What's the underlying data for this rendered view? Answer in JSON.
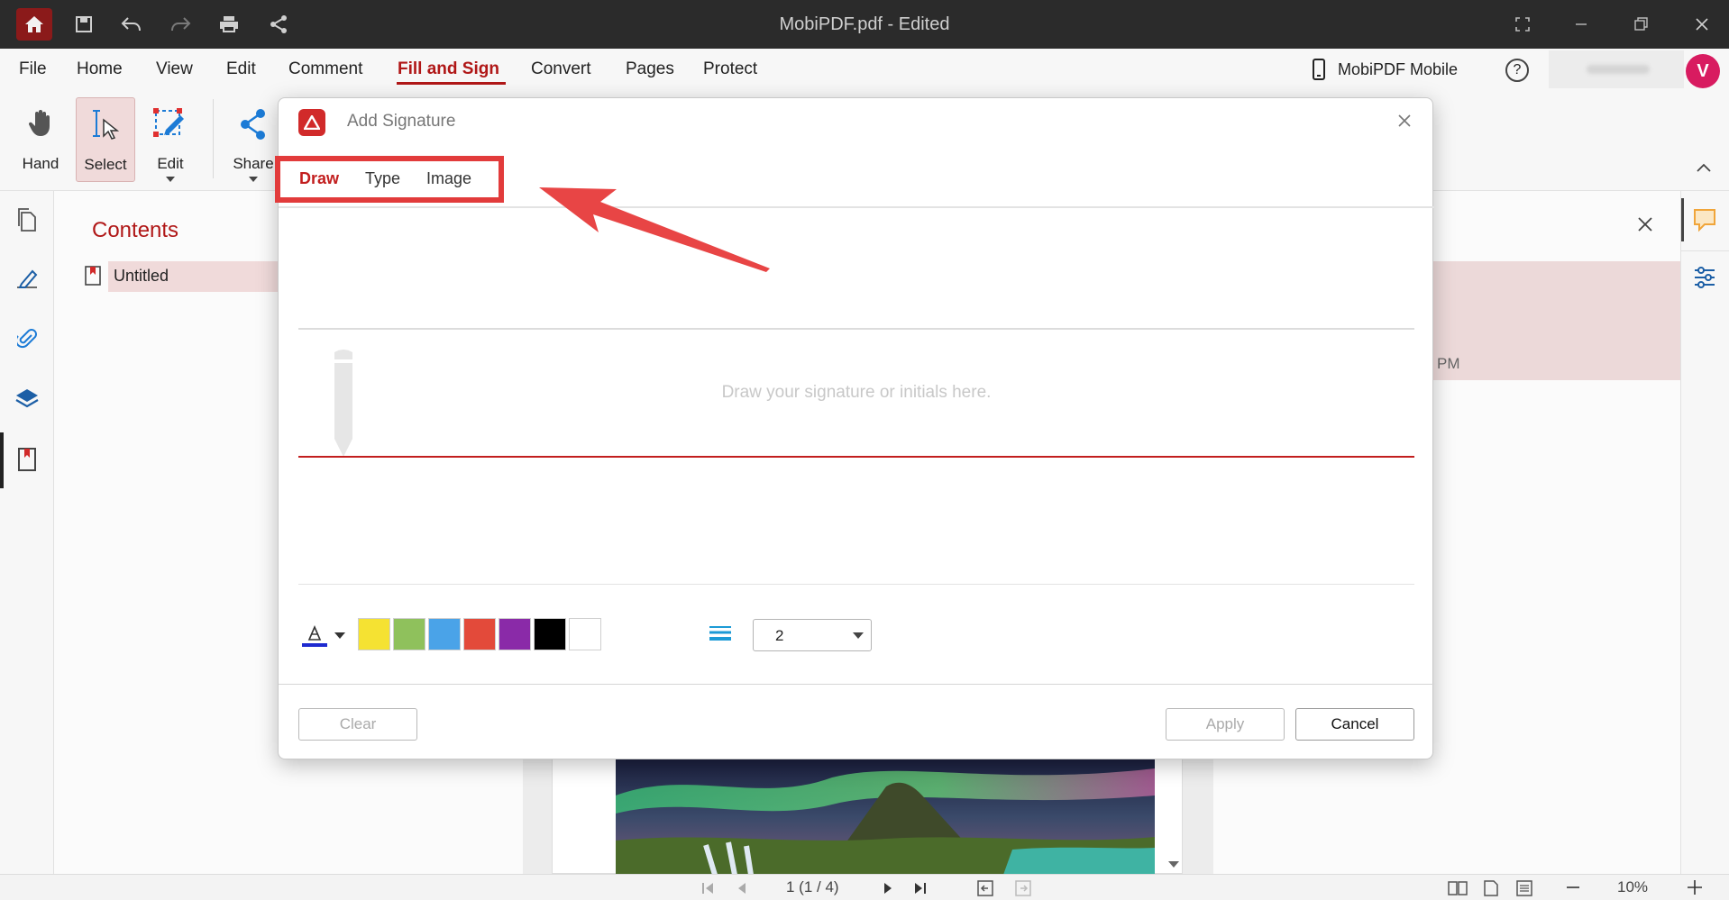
{
  "window": {
    "title": "MobiPDF.pdf - Edited"
  },
  "menu": {
    "items": [
      "File",
      "Home",
      "View",
      "Edit",
      "Comment",
      "Fill and Sign",
      "Convert",
      "Pages",
      "Protect"
    ],
    "active": "Fill and Sign",
    "mobile_label": "MobiPDF Mobile"
  },
  "ribbon": {
    "hand": "Hand",
    "select": "Select",
    "edit": "Edit",
    "share": "Share"
  },
  "contents_panel": {
    "title": "Contents",
    "items": [
      "Untitled"
    ]
  },
  "right_panel": {
    "time_fragment": "PM"
  },
  "statusbar": {
    "page_indicator": "1 (1 / 4)",
    "zoom": "10%"
  },
  "dialog": {
    "title": "Add Signature",
    "tabs": [
      "Draw",
      "Type",
      "Image"
    ],
    "active_tab": "Draw",
    "placeholder": "Draw your signature or initials here.",
    "colors": [
      "#f5e232",
      "#8fc15c",
      "#4aa3e8",
      "#e34a3a",
      "#8a2aa8",
      "#000000",
      "#ffffff"
    ],
    "pen_color": "#1e2ad0",
    "stroke_width": "2",
    "clear_label": "Clear",
    "apply_label": "Apply",
    "cancel_label": "Cancel"
  },
  "colors": {
    "accent": "#b01717",
    "annotation": "#e23b3b"
  }
}
